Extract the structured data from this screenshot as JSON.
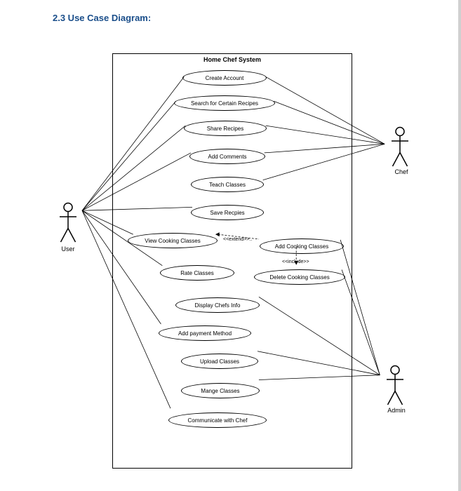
{
  "heading": "2.3 Use Case Diagram:",
  "system_title": "Home Chef System",
  "actors": {
    "user": "User",
    "chef": "Chef",
    "admin": "Admin"
  },
  "usecases": {
    "create_account": "Create Account",
    "search_recipes": "Search for Certain Recipes",
    "share_recipes": "Share Recipes",
    "add_comments": "Add Comments",
    "teach_classes": "Teach Classes",
    "save_recipes": "Save Recpies",
    "view_cooking_classes": "View Cooking Classes",
    "add_cooking_classes": "Add Cooking Classes",
    "rate_classes": "Rate Classes",
    "delete_cooking_classes": "Delete Cooking Classes",
    "display_chefs_info": "Display Chefs Info",
    "add_payment_method": "Add payment Method",
    "upload_classes": "Upload Classes",
    "manage_classes": "Mange Classes",
    "communicate_with_chef": "Communicate with Chef"
  },
  "stereotypes": {
    "extend": "<<extend>>..",
    "include": "<<include>>"
  },
  "chart_data": {
    "type": "uml-use-case",
    "system": "Home Chef System",
    "actors": [
      "User",
      "Chef",
      "Admin"
    ],
    "use_cases": [
      "Create Account",
      "Search for Certain Recipes",
      "Share Recipes",
      "Add Comments",
      "Teach Classes",
      "Save Recpies",
      "View Cooking Classes",
      "Add Cooking Classes",
      "Rate Classes",
      "Delete Cooking Classes",
      "Display Chefs Info",
      "Add payment Method",
      "Upload Classes",
      "Mange Classes",
      "Communicate with Chef"
    ],
    "associations": [
      {
        "actor": "User",
        "usecase": "Create Account"
      },
      {
        "actor": "User",
        "usecase": "Search for Certain Recipes"
      },
      {
        "actor": "User",
        "usecase": "Share Recipes"
      },
      {
        "actor": "User",
        "usecase": "Add Comments"
      },
      {
        "actor": "User",
        "usecase": "Save Recpies"
      },
      {
        "actor": "User",
        "usecase": "View Cooking Classes"
      },
      {
        "actor": "User",
        "usecase": "Rate Classes"
      },
      {
        "actor": "User",
        "usecase": "Add payment Method"
      },
      {
        "actor": "User",
        "usecase": "Communicate with Chef"
      },
      {
        "actor": "Chef",
        "usecase": "Create Account"
      },
      {
        "actor": "Chef",
        "usecase": "Search for Certain Recipes"
      },
      {
        "actor": "Chef",
        "usecase": "Share Recipes"
      },
      {
        "actor": "Chef",
        "usecase": "Add Comments"
      },
      {
        "actor": "Chef",
        "usecase": "Teach Classes"
      },
      {
        "actor": "Admin",
        "usecase": "Display Chefs Info"
      },
      {
        "actor": "Admin",
        "usecase": "Upload Classes"
      },
      {
        "actor": "Admin",
        "usecase": "Mange Classes"
      },
      {
        "actor": "Admin",
        "usecase": "Add Cooking Classes"
      },
      {
        "actor": "Admin",
        "usecase": "Delete Cooking Classes"
      }
    ],
    "relationships": [
      {
        "from": "View Cooking Classes",
        "to": "Add Cooking Classes",
        "type": "extend"
      },
      {
        "from": "Add Cooking Classes",
        "to": "Delete Cooking Classes",
        "type": "include"
      }
    ]
  }
}
